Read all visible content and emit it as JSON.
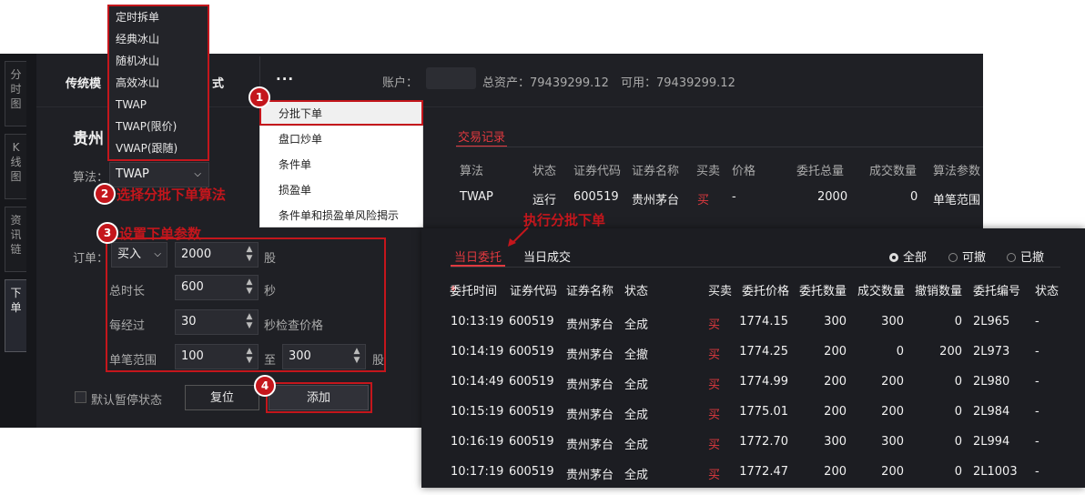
{
  "tabs_vertical": [
    "分时图",
    "K线图",
    "资讯链",
    "下单"
  ],
  "top": {
    "tab1": "传统模",
    "tab2": "式",
    "more": "···",
    "account_label": "账户：",
    "total_assets": "总资产：79439299.12",
    "available": "可用：79439299.12"
  },
  "stock_name": "贵州",
  "algo_menu": [
    "定时拆单",
    "经典冰山",
    "随机冰山",
    "高效冰山",
    "TWAP",
    "TWAP(限价)",
    "VWAP(跟随)"
  ],
  "more_menu": [
    "分批下单",
    "盘口炒单",
    "条件单",
    "损盈单",
    "条件单和损盈单风险揭示"
  ],
  "form": {
    "algo_label": "算法：",
    "algo_value": "TWAP",
    "order_label": "订单：",
    "side": "买入",
    "qty": "2000",
    "qty_unit": "股",
    "duration_label": "总时长",
    "duration": "600",
    "duration_unit": "秒",
    "interval_label": "每经过",
    "interval": "30",
    "interval_unit": "秒检查价格",
    "range_label": "单笔范围",
    "range_min": "100",
    "range_to": "至",
    "range_max": "300",
    "range_unit": "股",
    "pause_label": "默认暂停状态",
    "reset": "复位",
    "add": "添加"
  },
  "annotations": {
    "b1": "1",
    "b2": "2",
    "b3": "3",
    "b4": "4",
    "a2": "选择分批下单算法",
    "a3": "设置下单参数",
    "exec": "执行分批下单"
  },
  "trade_record": {
    "tab": "交易记录",
    "headers": [
      "算法",
      "状态",
      "证券代码",
      "证券名称",
      "买卖",
      "价格",
      "委托总量",
      "成交数量",
      "算法参数"
    ],
    "row": [
      "TWAP",
      "运行",
      "600519",
      "贵州茅台",
      "买",
      "-",
      "2000",
      "0",
      "单笔范围"
    ]
  },
  "orders": {
    "tab_active": "当日委托",
    "tab_other": "当日成交",
    "filters": [
      "全部",
      "可撤",
      "已撤"
    ],
    "headers": [
      "委托时间",
      "证券代码",
      "证券名称",
      "状态",
      "买卖",
      "委托价格",
      "委托数量",
      "成交数量",
      "撤销数量",
      "委托编号",
      "状态"
    ],
    "sort_mark": "♦",
    "rows": [
      [
        "10:13:19",
        "600519",
        "贵州茅台",
        "全成",
        "买",
        "1774.15",
        "300",
        "300",
        "0",
        "2L965",
        "-"
      ],
      [
        "10:14:19",
        "600519",
        "贵州茅台",
        "全撤",
        "买",
        "1774.25",
        "200",
        "0",
        "200",
        "2L973",
        "-"
      ],
      [
        "10:14:49",
        "600519",
        "贵州茅台",
        "全成",
        "买",
        "1774.99",
        "200",
        "200",
        "0",
        "2L980",
        "-"
      ],
      [
        "10:15:19",
        "600519",
        "贵州茅台",
        "全成",
        "买",
        "1775.01",
        "200",
        "200",
        "0",
        "2L984",
        "-"
      ],
      [
        "10:16:19",
        "600519",
        "贵州茅台",
        "全成",
        "买",
        "1772.70",
        "300",
        "300",
        "0",
        "2L994",
        "-"
      ],
      [
        "10:17:19",
        "600519",
        "贵州茅台",
        "全成",
        "买",
        "1772.47",
        "200",
        "200",
        "0",
        "2L1003",
        "-"
      ]
    ]
  }
}
